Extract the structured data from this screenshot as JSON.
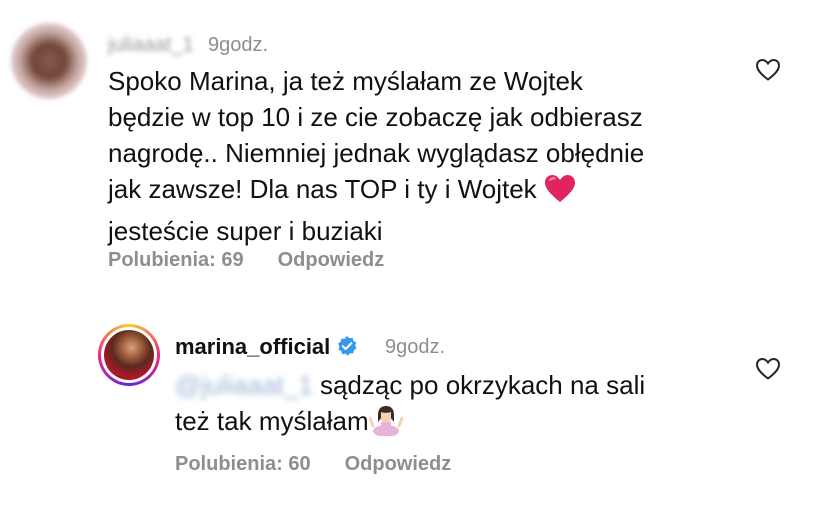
{
  "comments": [
    {
      "username": "juliaaat_1",
      "time": "9godz.",
      "lines": [
        "Spoko Marina, ja też myślałam ze Wojtek",
        "będzie w top 10 i ze cie zobaczę jak odbierasz",
        "nagrodę.. Niemniej jednak wyglądasz obłędnie",
        "jak zawsze! Dla nas TOP i ty i Wojtek",
        "jesteście super i buziaki"
      ],
      "likes_label": "Polubienia: 69",
      "reply_label": "Odpowiedz"
    },
    {
      "username": "marina_official",
      "time": "9godz.",
      "mention": "@juliaaat_1",
      "lines": [
        "sądząc po okrzykach na sali",
        "też tak myślałam"
      ],
      "likes_label": "Polubienia: 60",
      "reply_label": "Odpowiedz"
    }
  ],
  "icons": {
    "like": "heart-outline-icon",
    "verified": "verified-badge-icon",
    "heart_emoji": "red-heart-emoji",
    "shrug_emoji": "woman-shrugging-emoji"
  },
  "colors": {
    "verified": "#3897f0",
    "heart_emoji": "#e0245e",
    "meta": "#8e8e8e"
  }
}
